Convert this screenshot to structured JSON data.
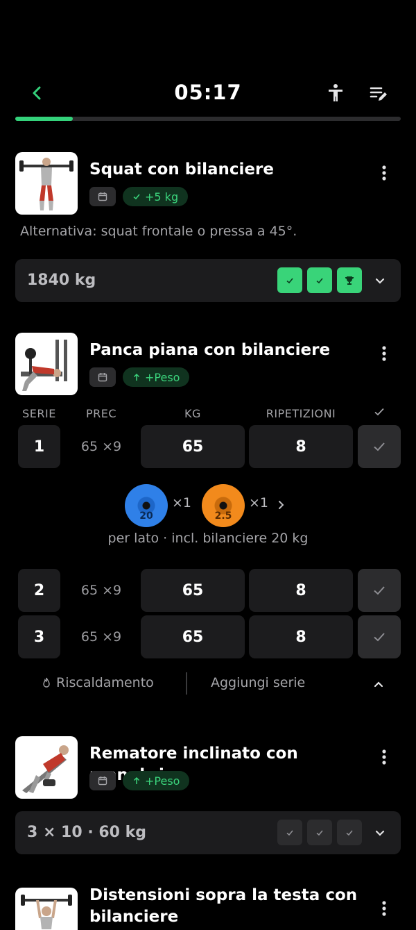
{
  "header": {
    "timer": "05:17",
    "progress": 0.15,
    "icons": [
      "back-icon",
      "body-icon",
      "edit-list-icon"
    ],
    "accent": "#34d27b"
  },
  "exercises": [
    {
      "title": "Squat con bilanciere",
      "tag": "+5 kg",
      "tag_icon": "check-icon",
      "note": "Alternativa: squat frontale o pressa a 45°.",
      "summary": "1840 kg",
      "chips": [
        "check",
        "check",
        "trophy"
      ]
    },
    {
      "title": "Panca piana con bilanciere",
      "tag": "+Peso",
      "tag_icon": "arrow-up-icon",
      "columns": {
        "set": "SERIE",
        "prev": "PREC",
        "kg": "KG",
        "reps": "RIPETIZIONI"
      },
      "sets": [
        {
          "set": "1",
          "prev": "65 ×9",
          "kg": "65",
          "reps": "8"
        },
        {
          "set": "2",
          "prev": "65 ×9",
          "kg": "65",
          "reps": "8"
        },
        {
          "set": "3",
          "prev": "65 ×9",
          "kg": "65",
          "reps": "8"
        }
      ],
      "plates": [
        {
          "weight": "20",
          "count": "×1",
          "color": "#2f80e8"
        },
        {
          "weight": "2.5",
          "count": "×1",
          "color": "#f28a1c"
        }
      ],
      "plates_note": "per lato · incl. bilanciere 20 kg",
      "warmup_label": "Riscaldamento",
      "add_set_label": "Aggiungi serie"
    },
    {
      "title": "Rematore inclinato con manubri",
      "tag": "+Peso",
      "tag_icon": "arrow-up-icon",
      "summary": "3 × 10 · 60 kg",
      "chips": [
        "check",
        "check",
        "check"
      ]
    },
    {
      "title": "Distensioni sopra la testa con bilanciere"
    }
  ]
}
